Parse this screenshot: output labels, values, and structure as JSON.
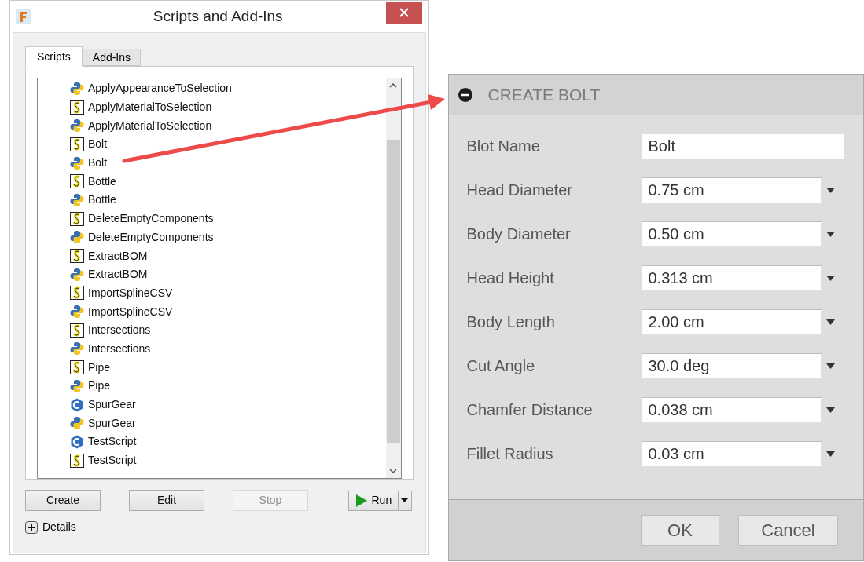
{
  "window": {
    "title": "Scripts and Add-Ins"
  },
  "tabs": [
    {
      "label": "Scripts",
      "selected": true
    },
    {
      "label": "Add-Ins",
      "selected": false
    }
  ],
  "scripts": [
    {
      "kind": "python",
      "name": "ApplyAppearanceToSelection"
    },
    {
      "kind": "javascript",
      "name": "ApplyMaterialToSelection"
    },
    {
      "kind": "python",
      "name": "ApplyMaterialToSelection"
    },
    {
      "kind": "javascript",
      "name": "Bolt"
    },
    {
      "kind": "python",
      "name": "Bolt"
    },
    {
      "kind": "javascript",
      "name": "Bottle"
    },
    {
      "kind": "python",
      "name": "Bottle"
    },
    {
      "kind": "javascript",
      "name": "DeleteEmptyComponents"
    },
    {
      "kind": "python",
      "name": "DeleteEmptyComponents"
    },
    {
      "kind": "javascript",
      "name": "ExtractBOM"
    },
    {
      "kind": "python",
      "name": "ExtractBOM"
    },
    {
      "kind": "javascript",
      "name": "ImportSplineCSV"
    },
    {
      "kind": "python",
      "name": "ImportSplineCSV"
    },
    {
      "kind": "javascript",
      "name": "Intersections"
    },
    {
      "kind": "python",
      "name": "Intersections"
    },
    {
      "kind": "javascript",
      "name": "Pipe"
    },
    {
      "kind": "python",
      "name": "Pipe"
    },
    {
      "kind": "cpp",
      "name": "SpurGear"
    },
    {
      "kind": "python",
      "name": "SpurGear"
    },
    {
      "kind": "cpp",
      "name": "TestScript"
    },
    {
      "kind": "javascript",
      "name": "TestScript"
    }
  ],
  "buttons": [
    {
      "label": "Create",
      "disabled": false
    },
    {
      "label": "Edit",
      "disabled": false
    },
    {
      "label": "Stop",
      "disabled": true
    }
  ],
  "run_button": {
    "label": "Run"
  },
  "details": {
    "label": "Details",
    "expanded": false
  },
  "dialog": {
    "title": "CREATE BOLT",
    "expanded": true,
    "fields": [
      {
        "kind": "text",
        "label": "Blot Name",
        "value": "Bolt"
      },
      {
        "kind": "dropdown",
        "label": "Head Diameter",
        "value": "0.75 cm"
      },
      {
        "kind": "dropdown",
        "label": "Body Diameter",
        "value": "0.50 cm"
      },
      {
        "kind": "dropdown",
        "label": "Head Height",
        "value": "0.313 cm"
      },
      {
        "kind": "dropdown",
        "label": "Body Length",
        "value": "2.00 cm"
      },
      {
        "kind": "dropdown",
        "label": "Cut Angle",
        "value": "30.0 deg"
      },
      {
        "kind": "dropdown",
        "label": "Chamfer Distance",
        "value": "0.038 cm"
      },
      {
        "kind": "dropdown",
        "label": "Fillet Radius",
        "value": "0.03 cm"
      }
    ],
    "buttons": [
      "OK",
      "Cancel"
    ]
  }
}
